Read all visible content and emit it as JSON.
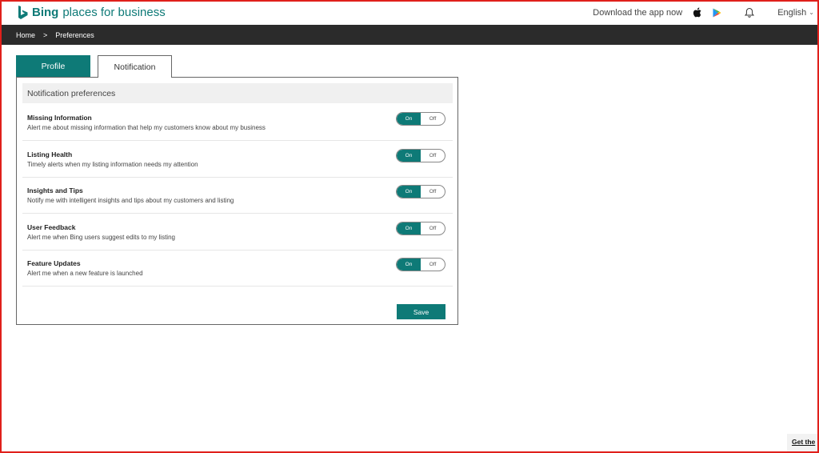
{
  "header": {
    "brand_bold": "Bing",
    "brand_rest": "places for business",
    "download_text": "Download the app now",
    "language": "English",
    "brand_color": "#0e7a77"
  },
  "breadcrumb": {
    "home": "Home",
    "separator": ">",
    "current": "Preferences"
  },
  "tabs": [
    {
      "label": "Profile",
      "active": false
    },
    {
      "label": "Notification",
      "active": true
    }
  ],
  "panel": {
    "heading": "Notification preferences",
    "items": [
      {
        "title": "Missing Information",
        "description": "Alert me about missing information that help my customers know about my business",
        "on_label": "On",
        "off_label": "Off"
      },
      {
        "title": "Listing Health",
        "description": "Timely alerts when my listing information needs my attention",
        "on_label": "On",
        "off_label": "Off"
      },
      {
        "title": "Insights and Tips",
        "description": "Notify me with intelligent insights and tips about my customers and listing",
        "on_label": "On",
        "off_label": "Off"
      },
      {
        "title": "User Feedback",
        "description": "Alert me when Bing users suggest edits to my listing",
        "on_label": "On",
        "off_label": "Off"
      },
      {
        "title": "Feature Updates",
        "description": "Alert me when a new feature is launched",
        "on_label": "On",
        "off_label": "Off"
      }
    ],
    "save_label": "Save"
  },
  "footer_link": "Get the"
}
